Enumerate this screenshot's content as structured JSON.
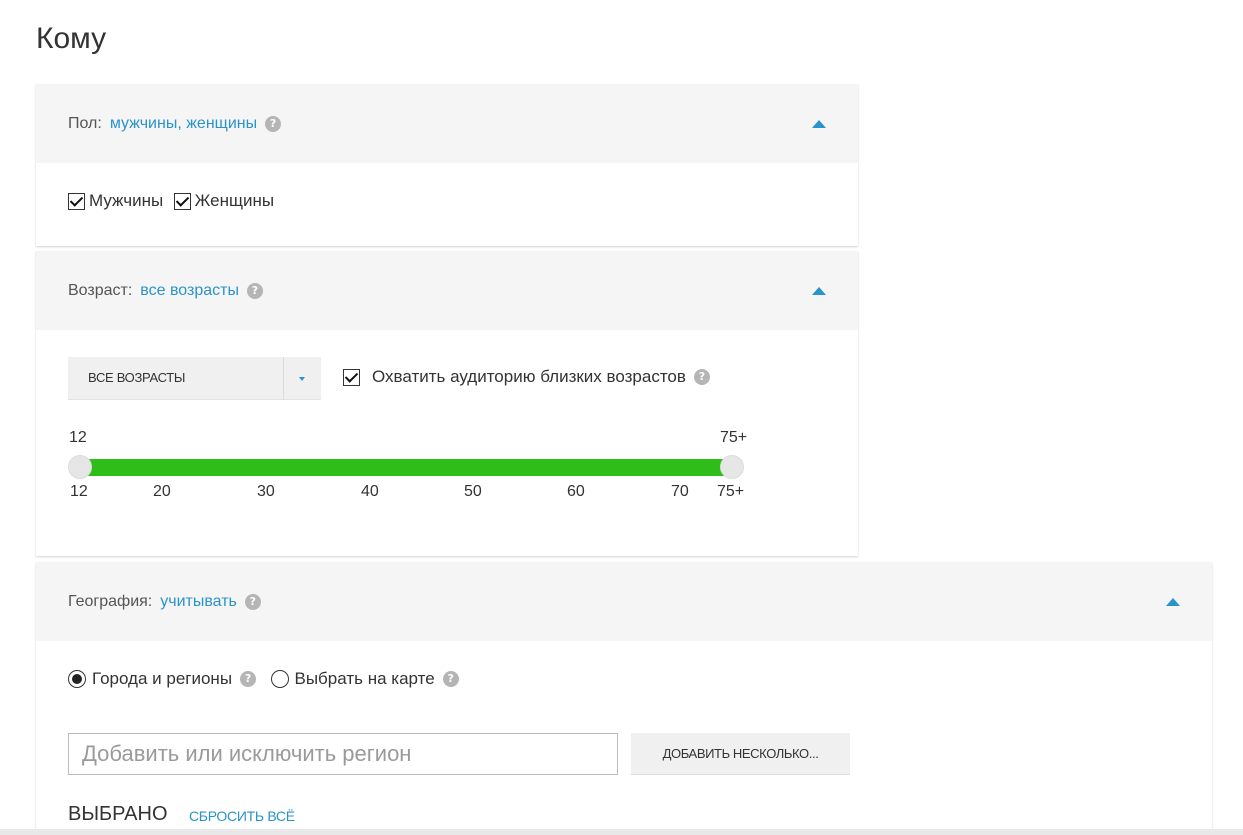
{
  "page": {
    "title": "Кому"
  },
  "gender": {
    "label": "Пол:",
    "value": "мужчины, женщины",
    "options": [
      {
        "label": "Мужчины",
        "checked": true
      },
      {
        "label": "Женщины",
        "checked": true
      }
    ]
  },
  "age": {
    "label": "Возраст:",
    "value": "все возрасты",
    "select_value": "ВСЕ ВОЗРАСТЫ",
    "near_ages_label": "Охватить аудиторию близких возрастов",
    "near_ages_checked": true,
    "slider": {
      "min_label": "12",
      "max_label": "75+",
      "ticks": [
        "12",
        "20",
        "30",
        "40",
        "50",
        "60",
        "70",
        "75+"
      ],
      "range_from": 12,
      "range_to": 75
    },
    "colors": {
      "track": "#2fbd1a",
      "accent": "#2a93c9"
    }
  },
  "geo": {
    "label": "География:",
    "value": "учитывать",
    "radio_cities": "Города и регионы",
    "radio_map": "Выбрать на карте",
    "selected_option": "cities",
    "input_placeholder": "Добавить или исключить регион",
    "add_many_label": "ДОБАВИТЬ НЕСКОЛЬКО...",
    "selected_title": "ВЫБРАНО",
    "reset_label": "СБРОСИТЬ ВСЁ"
  }
}
